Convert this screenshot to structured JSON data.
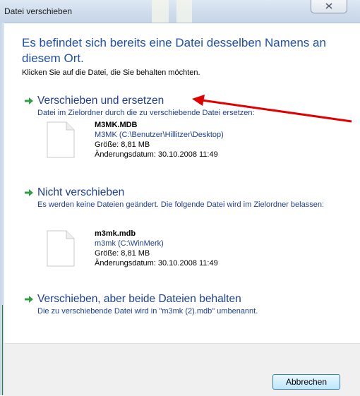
{
  "window": {
    "title": "Datei verschieben"
  },
  "heading": "Es befindet sich bereits eine Datei desselben Namens an diesem Ort.",
  "instruction": "Klicken Sie auf die Datei, die Sie behalten möchten.",
  "options": [
    {
      "title": "Verschieben und ersetzen",
      "description": "Datei im Zielordner durch die zu verschiebende Datei ersetzen:",
      "file": {
        "name": "M3MK.MDB",
        "location": "M3MK (C:\\Benutzer\\Hillitzer\\Desktop)",
        "size": "Größe: 8,81 MB",
        "modified": "Änderungsdatum: 30.10.2008 11:49"
      }
    },
    {
      "title": "Nicht verschieben",
      "description": "Es werden keine Dateien geändert. Die folgende Datei wird im Zielordner belassen:",
      "file": {
        "name": "m3mk.mdb",
        "location": "m3mk (C:\\WinMerk)",
        "size": "Größe: 8,81 MB",
        "modified": "Änderungsdatum: 30.10.2008 11:49"
      }
    },
    {
      "title": "Verschieben, aber beide Dateien behalten",
      "description": "Die zu verschiebende Datei wird in \"m3mk (2).mdb\" umbenannt."
    }
  ],
  "buttons": {
    "cancel": "Abbrechen"
  },
  "icons": {
    "option_arrow": "green-arrow-icon",
    "file": "document-icon",
    "close": "close-icon",
    "annotation": "red-arrow-annotation"
  },
  "colors": {
    "heading": "#1f4fa8",
    "link": "#1c3f94",
    "arrow_green": "#2ea043",
    "annotation_red": "#e00000"
  }
}
